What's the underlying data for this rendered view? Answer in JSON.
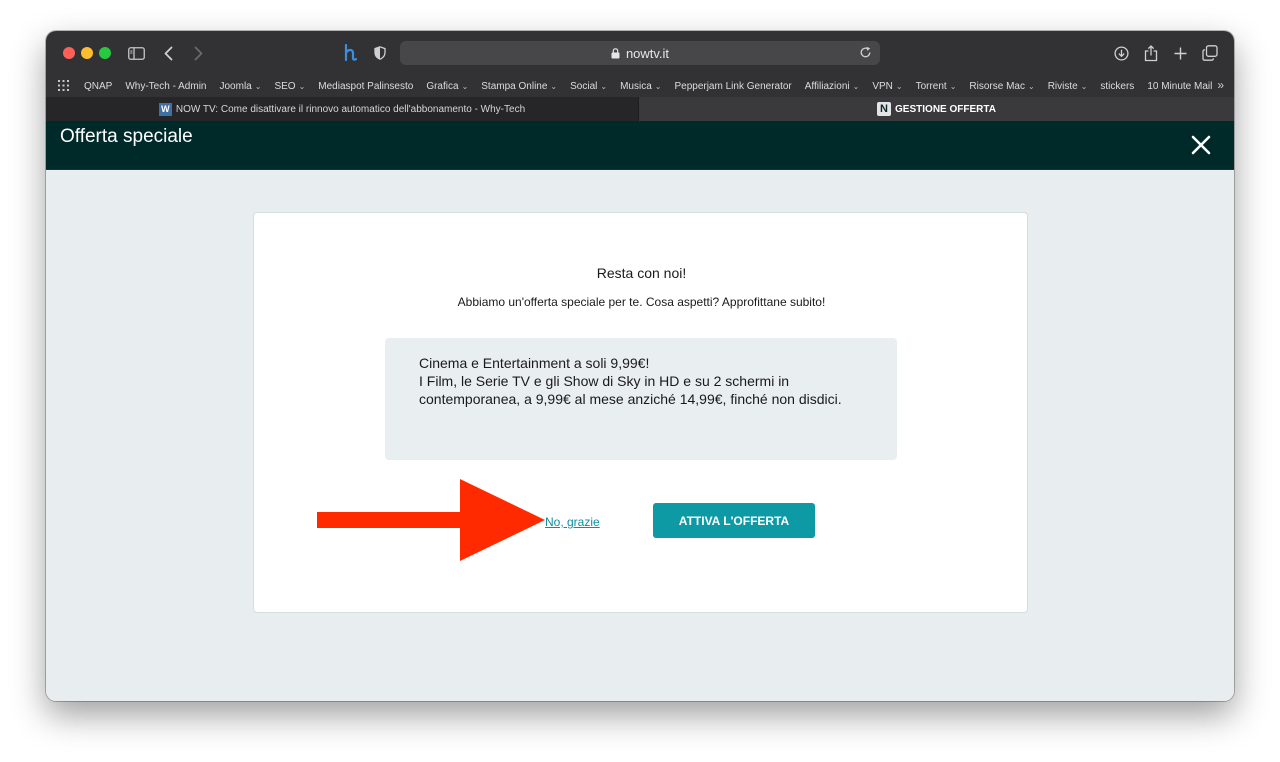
{
  "browser": {
    "address": "nowtv.it",
    "bookmarks": [
      {
        "label": "QNAP",
        "dropdown": false
      },
      {
        "label": "Why-Tech - Admin",
        "dropdown": false
      },
      {
        "label": "Joomla",
        "dropdown": true
      },
      {
        "label": "SEO",
        "dropdown": true
      },
      {
        "label": "Mediaspot Palinsesto",
        "dropdown": false
      },
      {
        "label": "Grafica",
        "dropdown": true
      },
      {
        "label": "Stampa Online",
        "dropdown": true
      },
      {
        "label": "Social",
        "dropdown": true
      },
      {
        "label": "Musica",
        "dropdown": true
      },
      {
        "label": "Pepperjam Link Generator",
        "dropdown": false
      },
      {
        "label": "Affiliazioni",
        "dropdown": true
      },
      {
        "label": "VPN",
        "dropdown": true
      },
      {
        "label": "Torrent",
        "dropdown": true
      },
      {
        "label": "Risorse Mac",
        "dropdown": true
      },
      {
        "label": "Riviste",
        "dropdown": true
      },
      {
        "label": "stickers",
        "dropdown": false
      },
      {
        "label": "10 Minute Mail",
        "dropdown": false
      }
    ],
    "tabs": [
      {
        "title": "NOW TV: Come disattivare il rinnovo automatico dell'abbonamento - Why-Tech",
        "active": false
      },
      {
        "title": "GESTIONE OFFERTA",
        "active": true
      }
    ]
  },
  "page": {
    "title": "Offerta speciale",
    "card": {
      "heading": "Resta con noi!",
      "subheading": "Abbiamo un'offerta speciale per te. Cosa aspetti? Approfittane subito!",
      "offer_line1": "Cinema e Entertainment a soli 9,99€!",
      "offer_line2": "I Film, le Serie TV e gli Show di Sky in HD e su 2 schermi in contemporanea, a 9,99€ al mese anziché 14,99€, finché non disdici.",
      "decline_label": "No, grazie",
      "accept_label": "ATTIVA L'OFFERTA"
    }
  },
  "colors": {
    "header_bg": "#00292a",
    "accent": "#0e9aa5",
    "link": "#0e8fa0",
    "annotation_arrow": "#ff2a00"
  }
}
